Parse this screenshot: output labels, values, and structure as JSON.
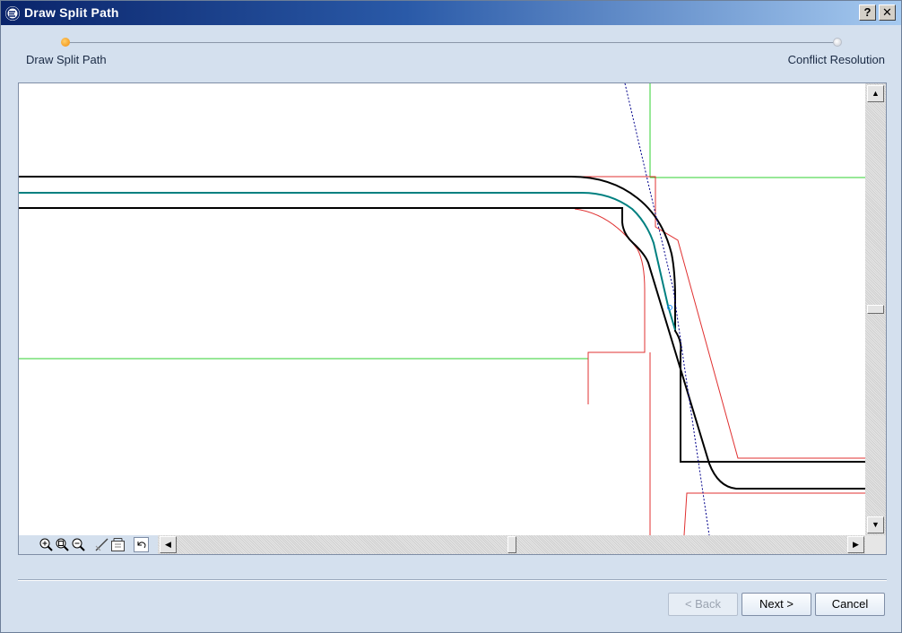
{
  "window": {
    "title": "Draw Split Path",
    "help_label": "?",
    "close_label": "✕"
  },
  "steps": {
    "items": [
      {
        "label": "Draw Split Path",
        "state": "active"
      },
      {
        "label": "Conflict Resolution",
        "state": "inactive"
      }
    ],
    "active_color": "#f08a0a"
  },
  "toolbar": {
    "tools": [
      "zoom-in-icon",
      "zoom-window-icon",
      "zoom-out-icon",
      "draw-line-icon",
      "fit-view-icon",
      "undo-icon"
    ]
  },
  "scrollbars": {
    "vertical": {
      "up_label": "▲",
      "down_label": "▼",
      "position": 0.5
    },
    "horizontal": {
      "left_label": "◀",
      "right_label": "▶",
      "position": 0.5
    }
  },
  "buttons": {
    "back_label": "< Back",
    "next_label": "Next >",
    "cancel_label": "Cancel"
  },
  "colors": {
    "road_outline": "#000000",
    "centerline": "#008080",
    "boundary_red": "#e03030",
    "grid_green": "#30d030",
    "split_path_blue": "#00008b"
  }
}
